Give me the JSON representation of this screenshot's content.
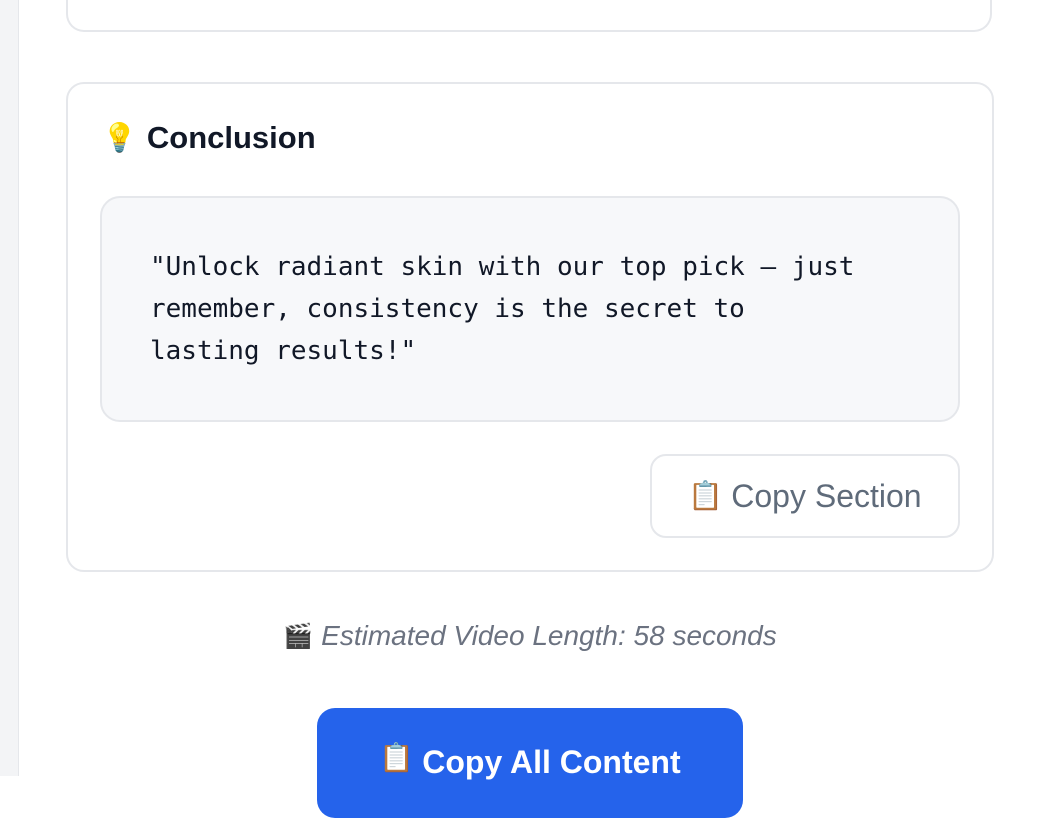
{
  "section": {
    "icon": "💡",
    "icon_name": "lightbulb-icon",
    "title": "Conclusion",
    "quote": "\"Unlock radiant skin with our top pick – just\nremember, consistency is the secret to\nlasting results!\"",
    "copy_button": {
      "icon": "📋",
      "icon_name": "clipboard-icon",
      "label": "Copy Section"
    }
  },
  "estimate": {
    "icon": "🎬",
    "icon_name": "clapperboard-icon",
    "text": "Estimated Video Length: 58 seconds"
  },
  "copy_all_button": {
    "icon": "📋",
    "icon_name": "clipboard-icon",
    "label": "Copy All Content",
    "color": "#2563eb"
  }
}
